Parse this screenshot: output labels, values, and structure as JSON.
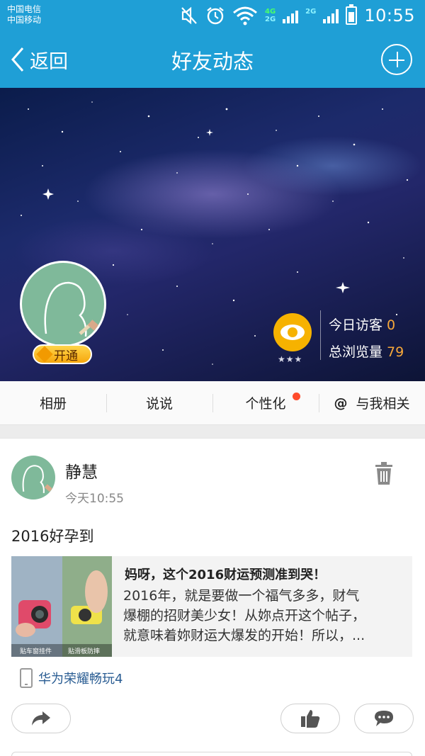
{
  "status_bar": {
    "carrier_1": "中国电信",
    "carrier_2": "中国移动",
    "net_4g": "4G",
    "net_2g": "2G",
    "time": "10:55",
    "icons": [
      "mute-icon",
      "alarm-icon",
      "wifi-icon",
      "signal-icon",
      "battery-icon"
    ]
  },
  "title_bar": {
    "back_label": "返回",
    "title": "好友动态",
    "add_icon": "plus-circle-icon"
  },
  "profile": {
    "open_badge": "开通",
    "stars": "★★★",
    "today_visitors_label": "今日访客",
    "today_visitors": "0",
    "total_views_label": "总浏览量",
    "total_views": "79"
  },
  "tabs": [
    {
      "label": "相册"
    },
    {
      "label": "说说"
    },
    {
      "label": "个性化",
      "has_dot": true
    },
    {
      "label": "与我相关",
      "prefix": "@"
    }
  ],
  "post": {
    "author": "静慧",
    "time": "今天10:55",
    "text": "2016好孕到",
    "share": {
      "title": "妈呀，这个2016财运预测准到哭！",
      "lines": [
        "2016年，就是要做一个福气多多，财气",
        "爆棚的招财美少女！从妳点开这个帖子，",
        "就意味着妳财运大爆发的开始！所以，..."
      ],
      "thumb_caption_left": "贴车窗挂件",
      "thumb_caption_right": "贴滑板防摔"
    },
    "device": "华为荣耀畅玩4"
  },
  "colors": {
    "primary": "#1f9fd6",
    "accent_orange": "#f7a83a",
    "badge_dot": "#ff4b2b",
    "link_blue": "#2a5d93"
  }
}
